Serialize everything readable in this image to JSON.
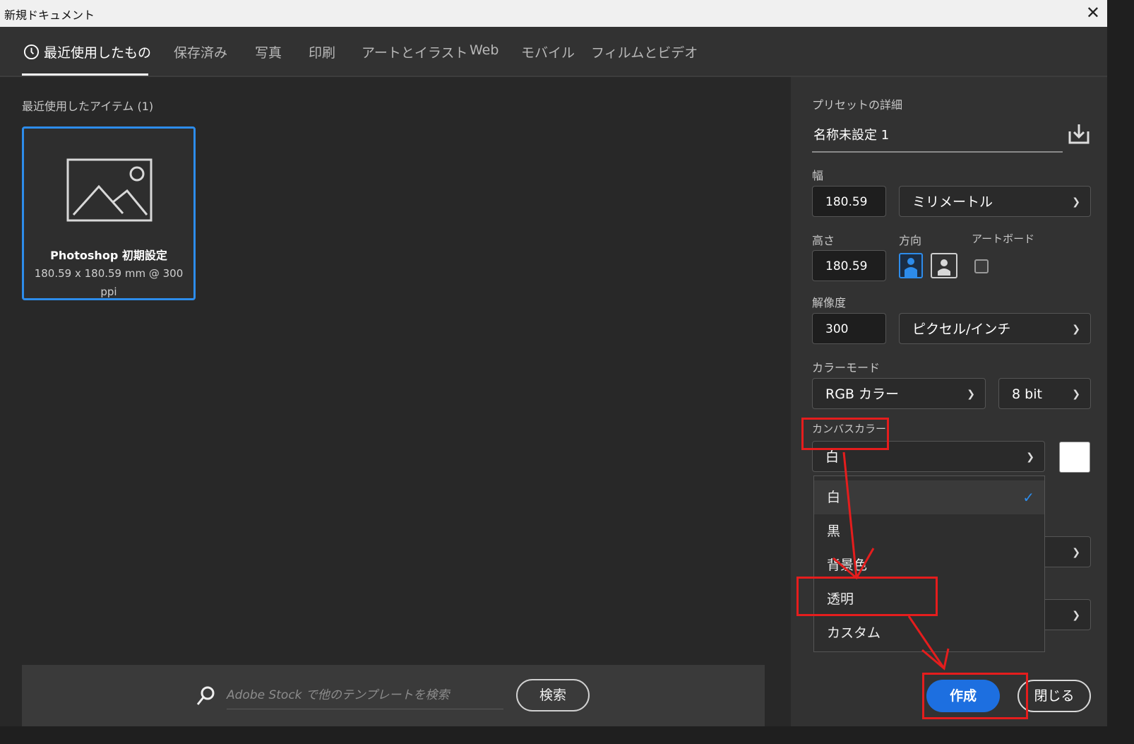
{
  "window": {
    "title": "新規ドキュメント",
    "close_glyph": "✕"
  },
  "tabs": [
    {
      "label": "最近使用したもの",
      "icon": "clock-icon"
    },
    {
      "label": "保存済み"
    },
    {
      "label": "写真"
    },
    {
      "label": "印刷"
    },
    {
      "label": "アートとイラスト"
    },
    {
      "label": "Web"
    },
    {
      "label": "モバイル"
    },
    {
      "label": "フィルムとビデオ"
    }
  ],
  "recent": {
    "heading": "最近使用したアイテム (1)",
    "items": [
      {
        "name": "Photoshop 初期設定",
        "dimensions": "180.59 x 180.59 mm @ 300 ppi",
        "icon": "image-placeholder-icon"
      }
    ]
  },
  "stock_search": {
    "placeholder": "Adobe Stock で他のテンプレートを検索",
    "button_label": "検索",
    "icon": "search-icon"
  },
  "preset": {
    "heading": "プリセットの詳細",
    "name": "名称未設定 1",
    "save_icon": "save-preset-icon",
    "width_label": "幅",
    "width_value": "180.59",
    "width_unit": "ミリメートル",
    "height_label": "高さ",
    "height_value": "180.59",
    "orientation_label": "方向",
    "artboard_label": "アートボード",
    "artboard_checked": false,
    "resolution_label": "解像度",
    "resolution_value": "300",
    "resolution_unit": "ピクセル/インチ",
    "color_mode_label": "カラーモード",
    "color_mode_value": "RGB カラー",
    "bit_depth_value": "8 bit",
    "canvas_color_label": "カンバスカラー",
    "canvas_color_value": "白",
    "canvas_swatch_color": "#ffffff"
  },
  "canvas_menu": {
    "options": [
      "白",
      "黒",
      "背景色",
      "透明",
      "カスタム"
    ],
    "selected_index": 0
  },
  "actions": {
    "create_label": "作成",
    "close_label": "閉じる"
  },
  "colors": {
    "accent": "#2d8ceb",
    "create_button": "#1d6fe0",
    "annotation_red": "#e51d1d"
  }
}
